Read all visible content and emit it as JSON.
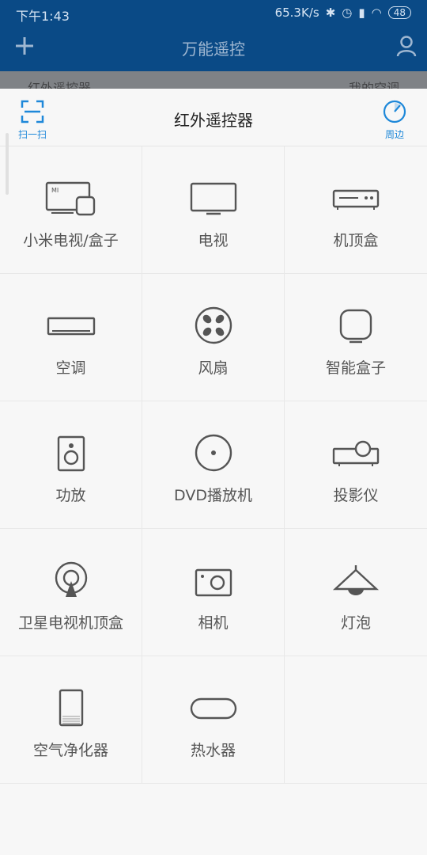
{
  "status_bar": {
    "time": "下午1:43",
    "network_speed": "65.3K/s",
    "battery": "48"
  },
  "app_bar": {
    "title": "万能遥控"
  },
  "underlay": {
    "left_text": "红外遥控器",
    "right_text": "我的空调"
  },
  "sheet": {
    "title": "红外遥控器",
    "scan_label": "扫一扫",
    "nearby_label": "周边",
    "accent": "#1e88d9"
  },
  "devices": [
    {
      "label": "小米电视/盒子",
      "icon": "mi-tv-box-icon"
    },
    {
      "label": "电视",
      "icon": "tv-icon"
    },
    {
      "label": "机顶盒",
      "icon": "set-top-box-icon"
    },
    {
      "label": "空调",
      "icon": "air-conditioner-icon"
    },
    {
      "label": "风扇",
      "icon": "fan-icon"
    },
    {
      "label": "智能盒子",
      "icon": "smart-box-icon"
    },
    {
      "label": "功放",
      "icon": "amplifier-icon"
    },
    {
      "label": "DVD播放机",
      "icon": "dvd-player-icon"
    },
    {
      "label": "投影仪",
      "icon": "projector-icon"
    },
    {
      "label": "卫星电视机顶盒",
      "icon": "satellite-box-icon"
    },
    {
      "label": "相机",
      "icon": "camera-icon"
    },
    {
      "label": "灯泡",
      "icon": "lamp-icon"
    },
    {
      "label": "空气净化器",
      "icon": "air-purifier-icon"
    },
    {
      "label": "热水器",
      "icon": "water-heater-icon"
    }
  ]
}
